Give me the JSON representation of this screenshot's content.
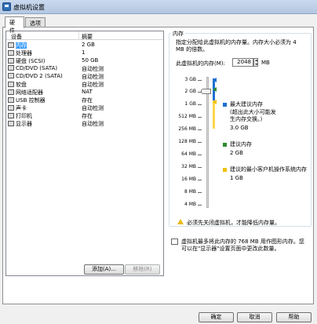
{
  "window": {
    "title": "虚拟机设置"
  },
  "tabs": [
    {
      "label": "硬件"
    },
    {
      "label": "选项"
    }
  ],
  "device_list": {
    "headers": {
      "device": "设备",
      "summary": "摘要"
    },
    "rows": [
      {
        "name": "内存",
        "summary": "2 GB",
        "icon": "memory-icon",
        "selected": true
      },
      {
        "name": "处理器",
        "summary": "1",
        "icon": "processor-icon"
      },
      {
        "name": "硬盘 (SCSI)",
        "summary": "50 GB",
        "icon": "hard-disk-icon"
      },
      {
        "name": "CD/DVD (SATA)",
        "summary": "自动检测",
        "icon": "cd-dvd-icon"
      },
      {
        "name": "CD/DVD 2 (SATA)",
        "summary": "自动检测",
        "icon": "cd-dvd-icon"
      },
      {
        "name": "软盘",
        "summary": "自动检测",
        "icon": "floppy-icon"
      },
      {
        "name": "网络适配器",
        "summary": "NAT",
        "icon": "network-adapter-icon"
      },
      {
        "name": "USB 控制器",
        "summary": "存在",
        "icon": "usb-controller-icon"
      },
      {
        "name": "声卡",
        "summary": "自动检测",
        "icon": "sound-card-icon"
      },
      {
        "name": "打印机",
        "summary": "存在",
        "icon": "printer-icon"
      },
      {
        "name": "显示器",
        "summary": "自动检测",
        "icon": "monitor-icon"
      }
    ],
    "add_label": "添加(A)...",
    "remove_label": "移除(R)"
  },
  "memory": {
    "group_title": "内存",
    "description": "指定分配给此虚拟机的内存量。内存大小必须为 4 MB 的倍数。",
    "field_label": "此虚拟机的内存(M):",
    "value": "2048",
    "unit": "MB",
    "scale": [
      "3 GB",
      "2 GB",
      "1 GB",
      "512 MB",
      "256 MB",
      "128 MB",
      "64 MB",
      "32 MB",
      "16 MB",
      "8 MB",
      "4 MB"
    ],
    "legend": [
      {
        "title": "最大建议内存",
        "note": "(超出此大小可能发生内存交换。)",
        "value": "3.0 GB",
        "color": "#1f6fd1"
      },
      {
        "title": "建议内存",
        "value": "2 GB",
        "color": "#2e8b2e"
      },
      {
        "title": "建议的最小客户机操作系统内存",
        "value": "1 GB",
        "color": "#f0c000"
      }
    ],
    "warning": "必须先关闭虚拟机，才能降低内存量。",
    "info": "虚拟机最多将此内存的 768 MB 用作图形内存。您可以在\"显示器\"设置页面中更改此数量。"
  },
  "footer": {
    "ok_label": "确定",
    "cancel_label": "取消",
    "help_label": "帮助"
  }
}
